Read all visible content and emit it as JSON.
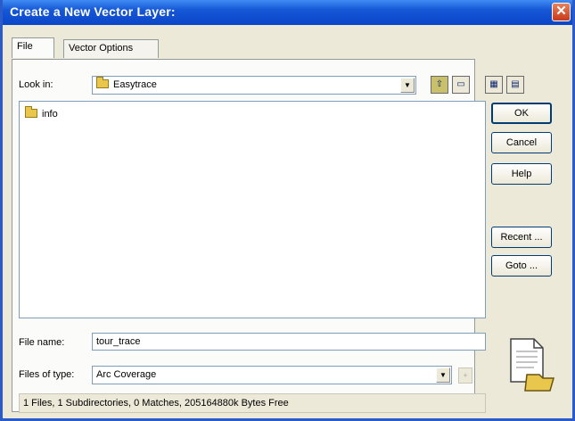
{
  "window": {
    "title": "Create a New Vector Layer:",
    "close_glyph": "✕"
  },
  "tabs": [
    {
      "label": "File",
      "active": true
    },
    {
      "label": "Vector Options",
      "active": false
    }
  ],
  "look_in": {
    "label": "Look in:",
    "value": "Easytrace",
    "icon": "folder-icon"
  },
  "toolbar": [
    {
      "name": "up-folder-button",
      "glyph": "⇧"
    },
    {
      "name": "new-folder-button",
      "glyph": "▭"
    },
    {
      "name": "connect-drive-button",
      "glyph": "▦"
    },
    {
      "name": "details-view-button",
      "glyph": "▤"
    }
  ],
  "files": [
    {
      "name": "info",
      "icon": "folder-icon"
    }
  ],
  "buttons": {
    "ok": "OK",
    "cancel": "Cancel",
    "help": "Help",
    "recent": "Recent ...",
    "goto": "Goto ..."
  },
  "file_name": {
    "label": "File name:",
    "value": "tour_trace"
  },
  "files_of_type": {
    "label": "Files of type:",
    "value": "Arc Coverage",
    "extra_button": "+"
  },
  "status": "1 Files, 1 Subdirectories, 0 Matches, 205164880k Bytes Free",
  "colors": {
    "titlebar": "#0a46c8",
    "dialog_bg": "#ECE9D8",
    "close": "#c8391a"
  }
}
